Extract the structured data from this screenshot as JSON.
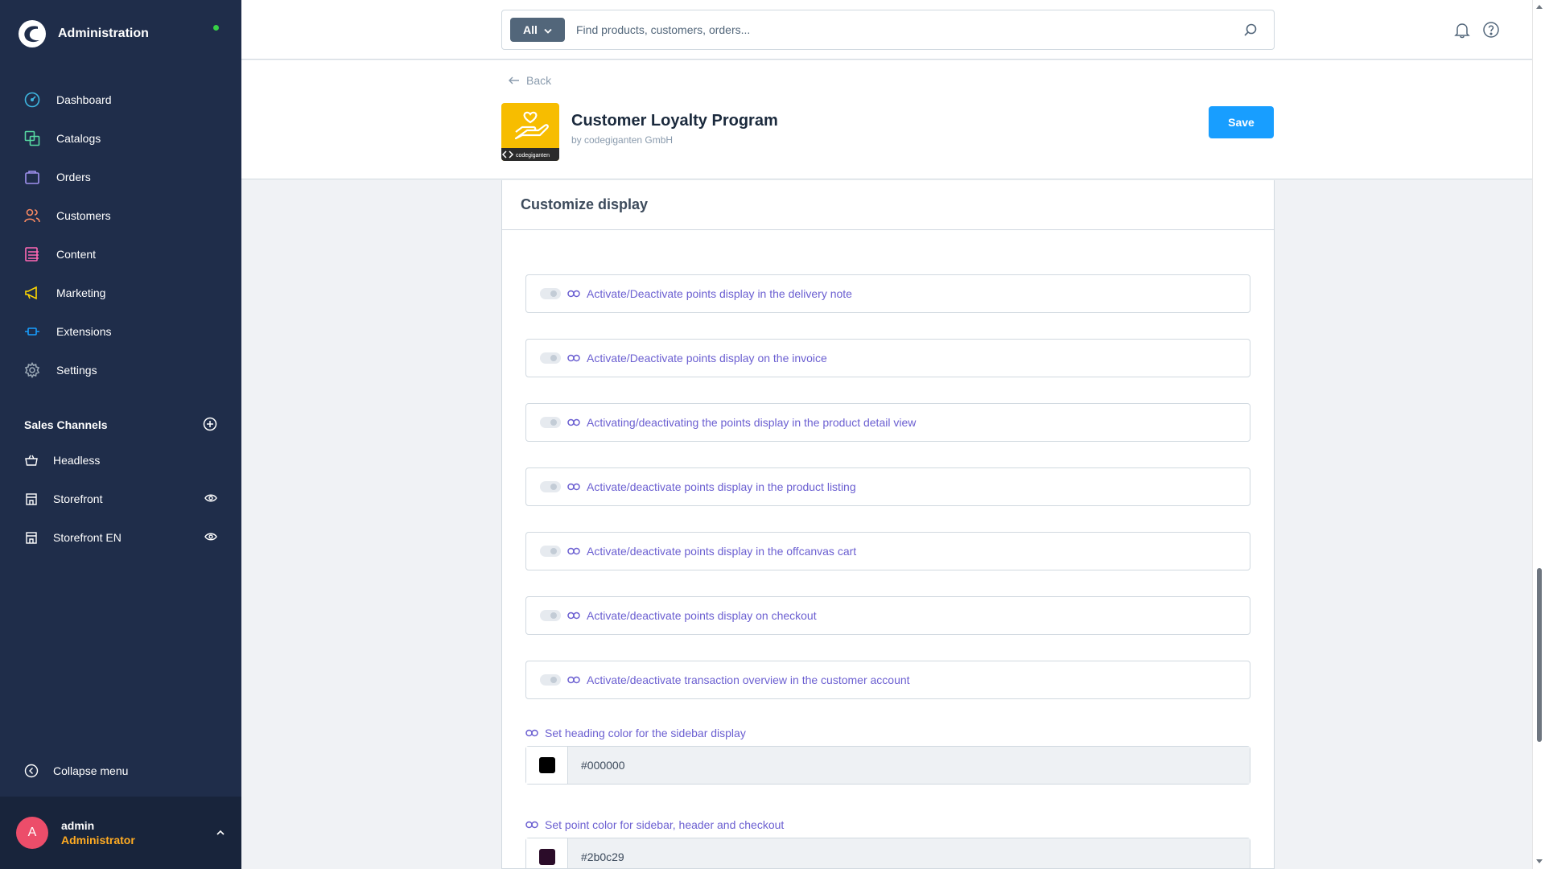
{
  "app": {
    "title": "Administration",
    "status_color": "#37d046"
  },
  "nav": {
    "items": [
      {
        "label": "Dashboard",
        "icon": "dashboard-icon",
        "color": "#3eb6e0"
      },
      {
        "label": "Catalogs",
        "icon": "catalogs-icon",
        "color": "#57d9a3"
      },
      {
        "label": "Orders",
        "icon": "orders-icon",
        "color": "#a092f0"
      },
      {
        "label": "Customers",
        "icon": "customers-icon",
        "color": "#f88962"
      },
      {
        "label": "Content",
        "icon": "content-icon",
        "color": "#ff68b4"
      },
      {
        "label": "Marketing",
        "icon": "marketing-icon",
        "color": "#ffd700"
      },
      {
        "label": "Extensions",
        "icon": "extensions-icon",
        "color": "#189eff"
      },
      {
        "label": "Settings",
        "icon": "settings-icon",
        "color": "#9aa8b5"
      }
    ]
  },
  "sales_channels": {
    "heading": "Sales Channels",
    "items": [
      {
        "label": "Headless",
        "icon": "basket-icon",
        "visible_icon": false
      },
      {
        "label": "Storefront",
        "icon": "storefront-icon",
        "visible_icon": true
      },
      {
        "label": "Storefront EN",
        "icon": "storefront-icon",
        "visible_icon": true
      }
    ]
  },
  "collapse_label": "Collapse menu",
  "user": {
    "initial": "A",
    "name": "admin",
    "role": "Administrator"
  },
  "search": {
    "type_label": "All",
    "placeholder": "Find products, customers, orders..."
  },
  "smartbar": {
    "back_label": "Back",
    "plugin_title": "Customer Loyalty Program",
    "plugin_by": "by codegiganten GmbH",
    "logo_text": "codegiganten",
    "save_label": "Save",
    "save_color": "#189eff"
  },
  "card": {
    "title": "Customize display",
    "toggles": [
      {
        "label": "Activate/Deactivate points display in the delivery note",
        "enabled": false
      },
      {
        "label": "Activate/Deactivate points display on the invoice",
        "enabled": false
      },
      {
        "label": "Activating/deactivating the points display in the product detail view",
        "enabled": false
      },
      {
        "label": "Activate/deactivate points display in the product listing",
        "enabled": false
      },
      {
        "label": "Activate/deactivate points display in the offcanvas cart",
        "enabled": false
      },
      {
        "label": "Activate/deactivate points display on checkout",
        "enabled": false
      },
      {
        "label": "Activate/deactivate transaction overview in the customer account",
        "enabled": false
      }
    ],
    "colors": [
      {
        "label": "Set heading color for the sidebar display",
        "value": "#000000"
      },
      {
        "label": "Set point color for sidebar, header and checkout",
        "value": "#2b0c29"
      }
    ]
  }
}
